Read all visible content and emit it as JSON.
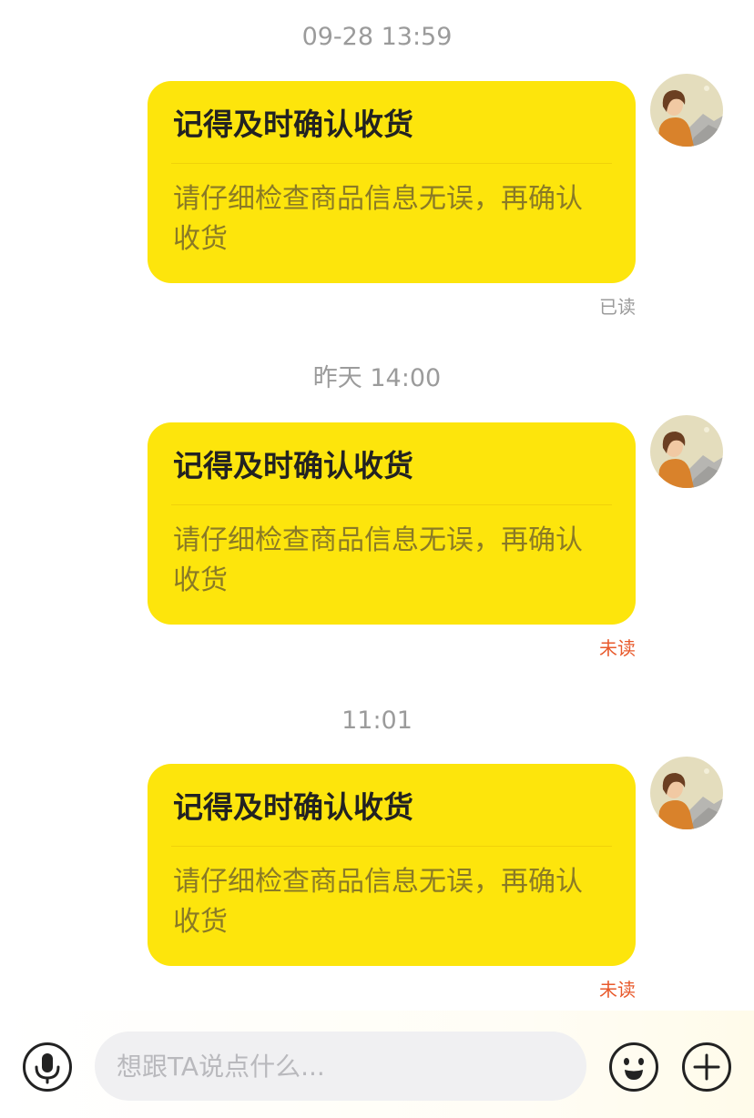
{
  "messages": [
    {
      "timestamp": "09-28 13:59",
      "title": "记得及时确认收货",
      "body": "请仔细检查商品信息无误，再确认收货",
      "status": "已读"
    },
    {
      "timestamp": "昨天 14:00",
      "title": "记得及时确认收货",
      "body": "请仔细检查商品信息无误，再确认收货",
      "status": "未读"
    },
    {
      "timestamp": "11:01",
      "title": "记得及时确认收货",
      "body": "请仔细检查商品信息无误，再确认收货",
      "status": "未读"
    }
  ],
  "input_bar": {
    "placeholder": "想跟TA说点什么...",
    "icons": {
      "voice": "microphone-icon",
      "emoji": "smiley-icon",
      "more": "plus-icon"
    }
  },
  "colors": {
    "bubble": "#fde50c",
    "unread": "#e85a2c",
    "read": "#9b9b9b"
  }
}
